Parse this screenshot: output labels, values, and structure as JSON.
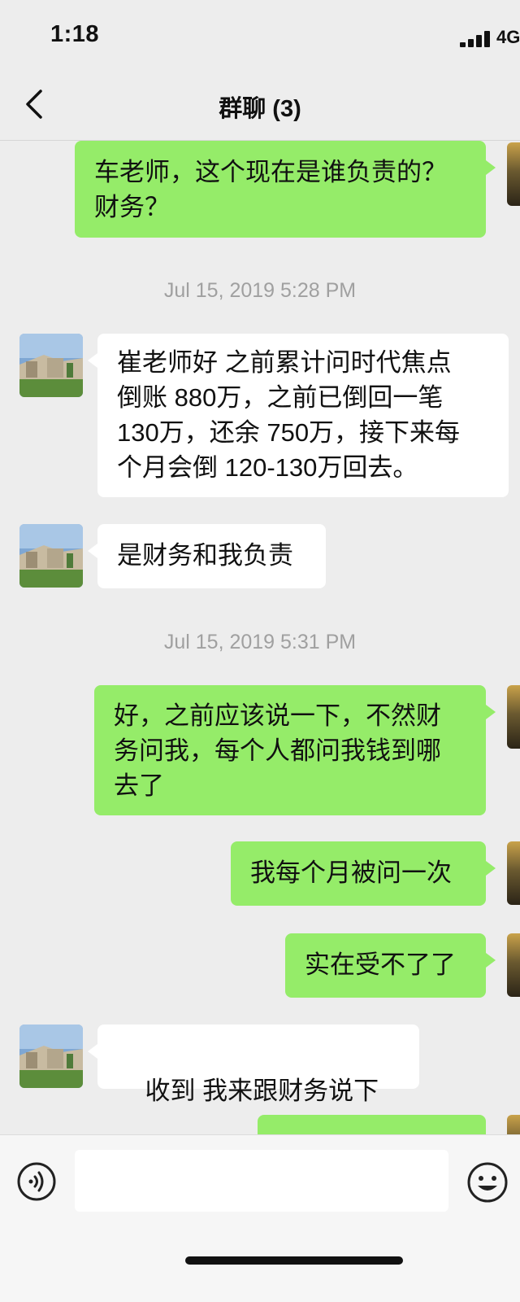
{
  "status_bar": {
    "time": "1:18",
    "network": "4G"
  },
  "header": {
    "title": "群聊 (3)"
  },
  "messages": [
    {
      "side": "me",
      "text": "车老师，这个现在是谁负责的？\n财务？"
    },
    {
      "side": "other",
      "text": "崔老师好 之前累计问时代焦点\n倒账 880万，之前已倒回一笔\n130万，还余 750万，接下来每\n个月会倒 120-130万回去。"
    },
    {
      "side": "other",
      "text": "是财务和我负责"
    },
    {
      "side": "me",
      "text": "好，之前应该说一下，不然财\n务问我，每个人都问我钱到哪\n去了"
    },
    {
      "side": "me",
      "text": "我每个月被问一次"
    },
    {
      "side": "me",
      "text": "实在受不了了"
    },
    {
      "side": "other",
      "text": "收到 我来跟财务说下",
      "emoji": "ok-hand-emoji"
    },
    {
      "side": "me",
      "text": ""
    }
  ],
  "timestamps": [
    "Jul 15, 2019 5:28 PM",
    "Jul 15, 2019 5:31 PM"
  ],
  "input": {
    "placeholder": "",
    "value": ""
  },
  "icons": {
    "back": "chevron-left-icon",
    "voice": "voice-icon",
    "emoji": "smiley-icon"
  },
  "colors": {
    "background": "#ededed",
    "my_bubble": "#95ec69",
    "other_bubble": "#ffffff",
    "timestamp": "#a0a0a0"
  }
}
